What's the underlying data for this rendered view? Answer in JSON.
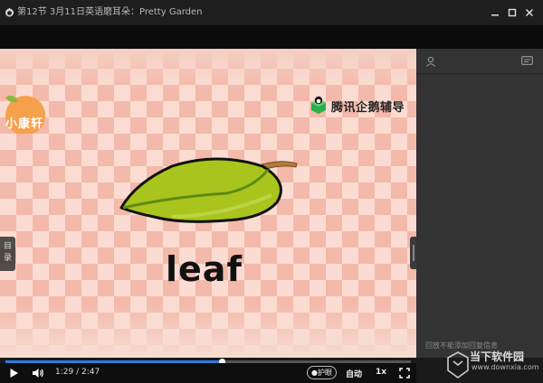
{
  "window": {
    "title": "第12节 3月11日英语磨耳朵：Pretty Garden",
    "buttons": [
      "minimize-icon",
      "maximize-icon",
      "close-icon"
    ]
  },
  "video": {
    "course_logo_text": "小康轩",
    "brand_text": "腾讯企鹅辅导",
    "word": "leaf",
    "catalog_tab": "目录"
  },
  "side_panel": {
    "icons": [
      "user-icon",
      "message-icon"
    ],
    "notice": "回放不能添加回复信息"
  },
  "player": {
    "time": "1:29 / 2:47",
    "progress": 0.534,
    "eye_care_label": "护眼",
    "auto_label": "自动",
    "speed_label": "1x"
  },
  "watermark": {
    "name": "当下软件园",
    "url": "www.downxia.com"
  },
  "colors": {
    "accent": "#2f7de1",
    "leaf_green": "#9fbe1a",
    "panel": "#333333"
  }
}
